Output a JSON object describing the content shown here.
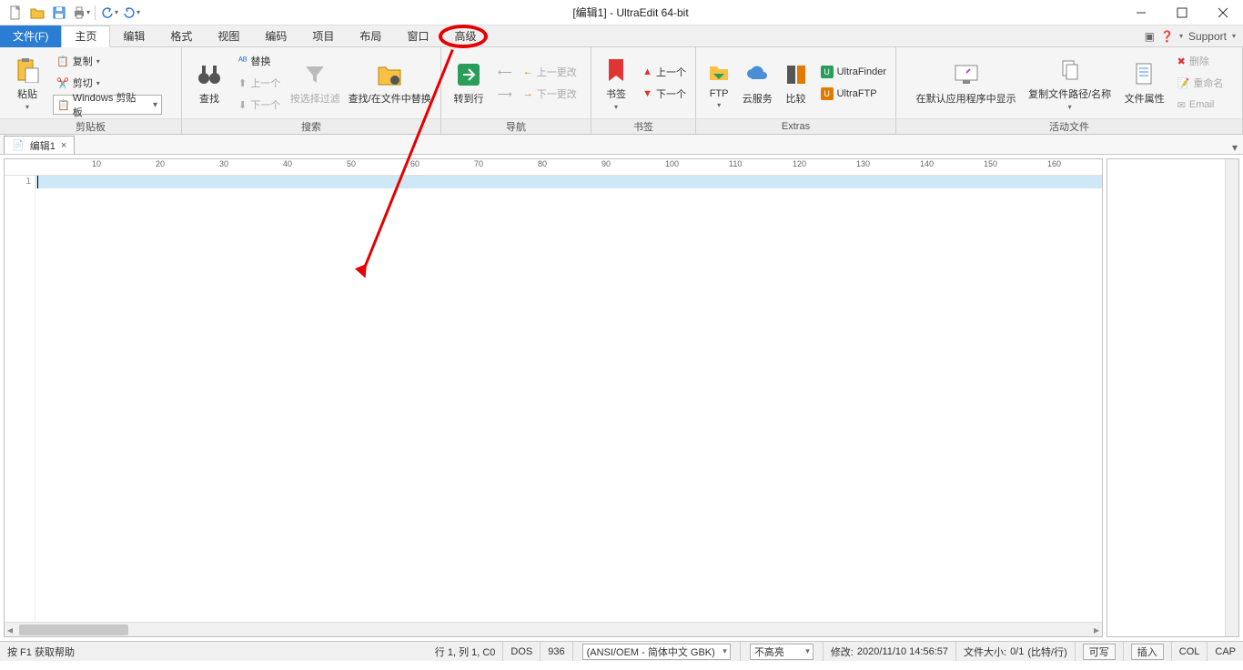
{
  "title": "[编辑1] - UltraEdit 64-bit",
  "qat_icons": [
    "new-file-icon",
    "open-folder-icon",
    "save-icon",
    "print-icon",
    "undo-icon",
    "redo-icon"
  ],
  "menu": {
    "file": "文件(F)",
    "items": [
      "主页",
      "编辑",
      "格式",
      "视图",
      "编码",
      "项目",
      "布局",
      "窗口",
      "高级"
    ],
    "active": "主页",
    "support": "Support"
  },
  "ribbon": {
    "clipboard": {
      "title": "剪贴板",
      "paste": "粘贴",
      "copy": "复制",
      "cut": "剪切",
      "clipboard_combo": "Windows 剪贴板"
    },
    "search": {
      "title": "搜索",
      "find": "查找",
      "replace": "替换",
      "prev": "上一个",
      "next": "下一个",
      "filter": "按选择过滤",
      "find_in_files": "查找/在文件中替换"
    },
    "nav": {
      "title": "导航",
      "goto": "转到行",
      "prev_change": "上一更改",
      "next_change": "下一更改"
    },
    "bookmark": {
      "title": "书签",
      "bookmark": "书签",
      "prev": "上一个",
      "next": "下一个"
    },
    "extras": {
      "title": "Extras",
      "ftp": "FTP",
      "cloud": "云服务",
      "compare": "比较",
      "ultrafinder": "UltraFinder",
      "ultraftp": "UltraFTP"
    },
    "active_file": {
      "title": "活动文件",
      "open_default": "在默认应用程序中显示",
      "copy_path": "复制文件路径/名称",
      "props": "文件属性",
      "delete": "删除",
      "rename": "重命名",
      "email": "Email"
    }
  },
  "doc_tab": {
    "name": "编辑1"
  },
  "ruler": {
    "step": 10,
    "max": 160
  },
  "editor": {
    "line_number": "1"
  },
  "status": {
    "help": "按 F1 获取帮助",
    "position": "行 1, 列 1, C0",
    "line_end": "DOS",
    "codepage": "936",
    "encoding": "(ANSI/OEM - 简体中文 GBK)",
    "highlight": "不高亮",
    "modified_label": "修改:",
    "modified_value": "2020/11/10 14:56:57",
    "size_label": "文件大小:",
    "size_value": "0/1",
    "size_unit": "(比特/行)",
    "readwrite": "可写",
    "insert": "插入",
    "col": "COL",
    "cap": "CAP"
  },
  "colors": {
    "accent": "#2b7cd3",
    "annotation": "#e60000",
    "highlight": "#cfe8f7"
  }
}
